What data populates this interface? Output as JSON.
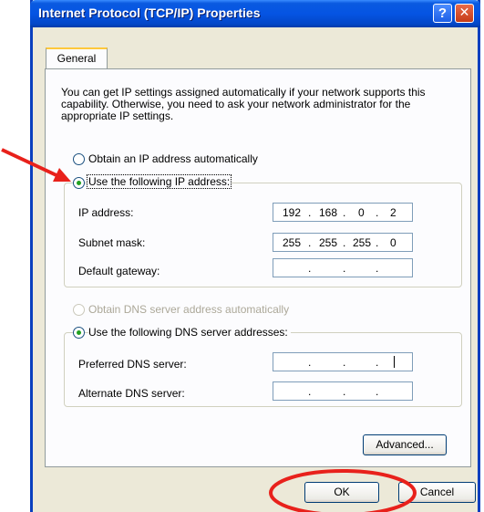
{
  "window": {
    "title": "Internet Protocol (TCP/IP) Properties",
    "help_glyph": "?",
    "close_glyph": "✕"
  },
  "tabs": [
    {
      "label": "General"
    }
  ],
  "description": "You can get IP settings assigned automatically if your network supports this capability. Otherwise, you need to ask your network administrator for the appropriate IP settings.",
  "ip_mode": {
    "auto_label": "Obtain an IP address automatically",
    "manual_label": "Use the following IP address:",
    "selected": "manual"
  },
  "ip_fields": {
    "ip_address": {
      "label": "IP address:",
      "octets": [
        "192",
        "168",
        "0",
        "2"
      ]
    },
    "subnet_mask": {
      "label": "Subnet mask:",
      "octets": [
        "255",
        "255",
        "255",
        "0"
      ]
    },
    "default_gateway": {
      "label": "Default gateway:",
      "octets": [
        "",
        "",
        "",
        ""
      ]
    }
  },
  "dns_mode": {
    "auto_label": "Obtain DNS server address automatically",
    "manual_label": "Use the following DNS server addresses:",
    "selected": "manual"
  },
  "dns_fields": {
    "preferred": {
      "label": "Preferred DNS server:",
      "octets": [
        "",
        "",
        "",
        ""
      ]
    },
    "alternate": {
      "label": "Alternate DNS server:",
      "octets": [
        "",
        "",
        "",
        ""
      ]
    }
  },
  "buttons": {
    "advanced": "Advanced...",
    "ok": "OK",
    "cancel": "Cancel"
  },
  "annotations": {
    "arrow_color": "#e8211b",
    "circle_color": "#e8211b"
  }
}
